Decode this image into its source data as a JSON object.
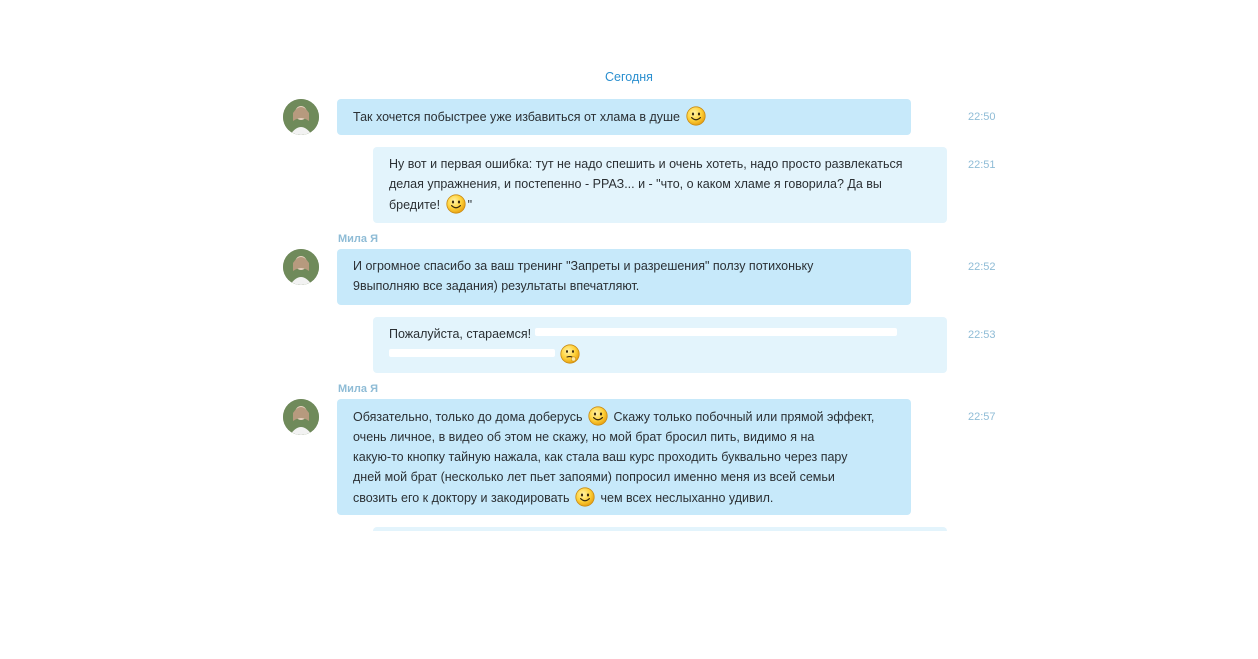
{
  "date_separator": "Сегодня",
  "messages": [
    {
      "direction": "in",
      "sender": "",
      "time": "22:50",
      "parts": [
        "Так хочется побыстрее уже избавиться от хлама в душе"
      ]
    },
    {
      "direction": "out",
      "time": "22:51",
      "parts": [
        "Ну вот и первая ошибка: тут не надо спешить и очень хотеть, надо просто развлекаться",
        "делая упражнения, и постепенно - РРАЗ... и - \"что, о каком хламе я говорила? Да вы",
        "бредите!",
        "\""
      ]
    },
    {
      "direction": "in",
      "sender": "Мила Я",
      "time": "22:52",
      "parts": [
        "И огромное спасибо за ваш тренинг \"Запреты и разрешения\" ползу потихоньку",
        "9выполняю все задания)  результаты впечатляют."
      ]
    },
    {
      "direction": "out",
      "time": "22:53",
      "parts": [
        "Пожалуйста, стараемся!"
      ]
    },
    {
      "direction": "in",
      "sender": "Мила Я",
      "time": "22:57",
      "parts": [
        "Обязательно, только до дома доберусь",
        "Скажу только побочный или прямой эффект,",
        "очень личное, в видео об этом не скажу, но мой брат бросил пить, видимо я на",
        "какую-то кнопку тайную нажала, как стала ваш курс проходить буквально через пару",
        "дней мой брат (несколько лет пьет запоями) попросил именно меня из всей семьи",
        "свозить его к доктору и закодировать",
        "чем всех неслыханно удивил."
      ]
    }
  ],
  "icons": {
    "smiley": "smile-emoticon-icon",
    "thinking": "thinking-emoticon-icon"
  },
  "colors": {
    "incoming_bubble": "#c7e9fa",
    "outgoing_bubble": "#e3f4fc",
    "date_text": "#2b8fcf",
    "meta_text": "#8fbcd6"
  }
}
